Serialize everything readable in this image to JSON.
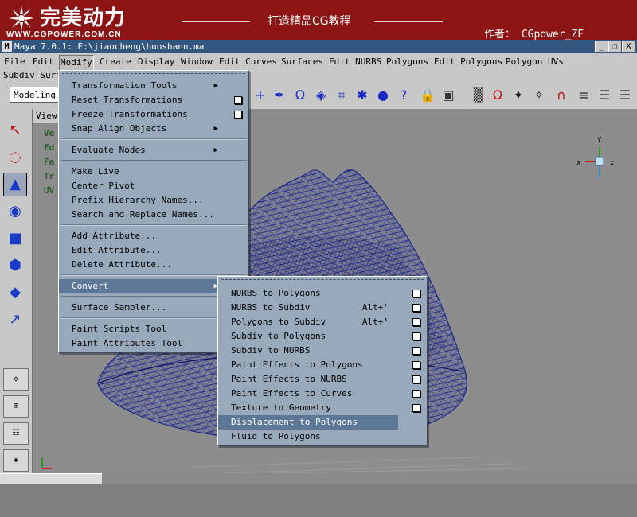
{
  "banner": {
    "logo_cn": "完美动力",
    "logo_url": "WWW.CGPOWER.COM.CN",
    "title": "打造精品CG教程",
    "author": "作者：  CGpower_ZF"
  },
  "window": {
    "app_icon": "M",
    "title": "Maya 7.0.1: E:\\jiaocheng\\huoshann.ma",
    "minimize": "_",
    "restore": "❐",
    "close": "X"
  },
  "menubar": {
    "items": [
      "File",
      "Edit",
      "Modify",
      "Create",
      "Display",
      "Window",
      "Edit Curves",
      "Surfaces",
      "Edit NURBS",
      "Polygons",
      "Edit Polygons",
      "Polygon UVs"
    ],
    "row2": "Subdiv Surf"
  },
  "toolbar": {
    "mode": "Modeling"
  },
  "viewport": {
    "menu": "View",
    "hud": [
      "Ve",
      "Ed",
      "Fa",
      "Tr",
      "UV"
    ],
    "axis_labels": {
      "x": "x",
      "y": "y",
      "z": "z"
    }
  },
  "modify_menu": {
    "items": [
      {
        "label": "Transformation Tools",
        "submenu": true
      },
      {
        "label": "Reset Transformations",
        "option": true
      },
      {
        "label": "Freeze Transformations",
        "option": true
      },
      {
        "label": "Snap Align Objects",
        "submenu": true
      },
      {
        "label": "Evaluate Nodes",
        "submenu": true
      },
      {
        "label": "Make Live"
      },
      {
        "label": "Center Pivot"
      },
      {
        "label": "Prefix Hierarchy Names..."
      },
      {
        "label": "Search and Replace Names..."
      },
      {
        "label": "Add Attribute..."
      },
      {
        "label": "Edit Attribute..."
      },
      {
        "label": "Delete Attribute..."
      },
      {
        "label": "Convert",
        "submenu": true,
        "highlighted": true
      },
      {
        "label": "Surface Sampler..."
      },
      {
        "label": "Paint Scripts Tool"
      },
      {
        "label": "Paint Attributes Tool"
      }
    ]
  },
  "convert_menu": {
    "items": [
      {
        "label": "NURBS to Polygons",
        "option": true
      },
      {
        "label": "NURBS to Subdiv",
        "shortcut": "Alt+'",
        "option": true
      },
      {
        "label": "Polygons to Subdiv",
        "shortcut": "Alt+'",
        "option": true
      },
      {
        "label": "Subdiv to Polygons",
        "option": true
      },
      {
        "label": "Subdiv to NURBS",
        "option": true
      },
      {
        "label": "Paint Effects to Polygons",
        "option": true
      },
      {
        "label": "Paint Effects to NURBS",
        "option": true
      },
      {
        "label": "Paint Effects to Curves",
        "option": true
      },
      {
        "label": "Texture to Geometry",
        "option": true
      },
      {
        "label": "Displacement to Polygons",
        "highlighted": true
      },
      {
        "label": "Fluid to Polygons"
      }
    ]
  },
  "colors": {
    "banner": "#8c1414",
    "titlebar": "#33577e",
    "menu_bg": "#98a9bc",
    "menu_highlight": "#5d7796",
    "mesh_wire": "#1c2a8a",
    "viewport_bg": "#8d8d8d"
  }
}
